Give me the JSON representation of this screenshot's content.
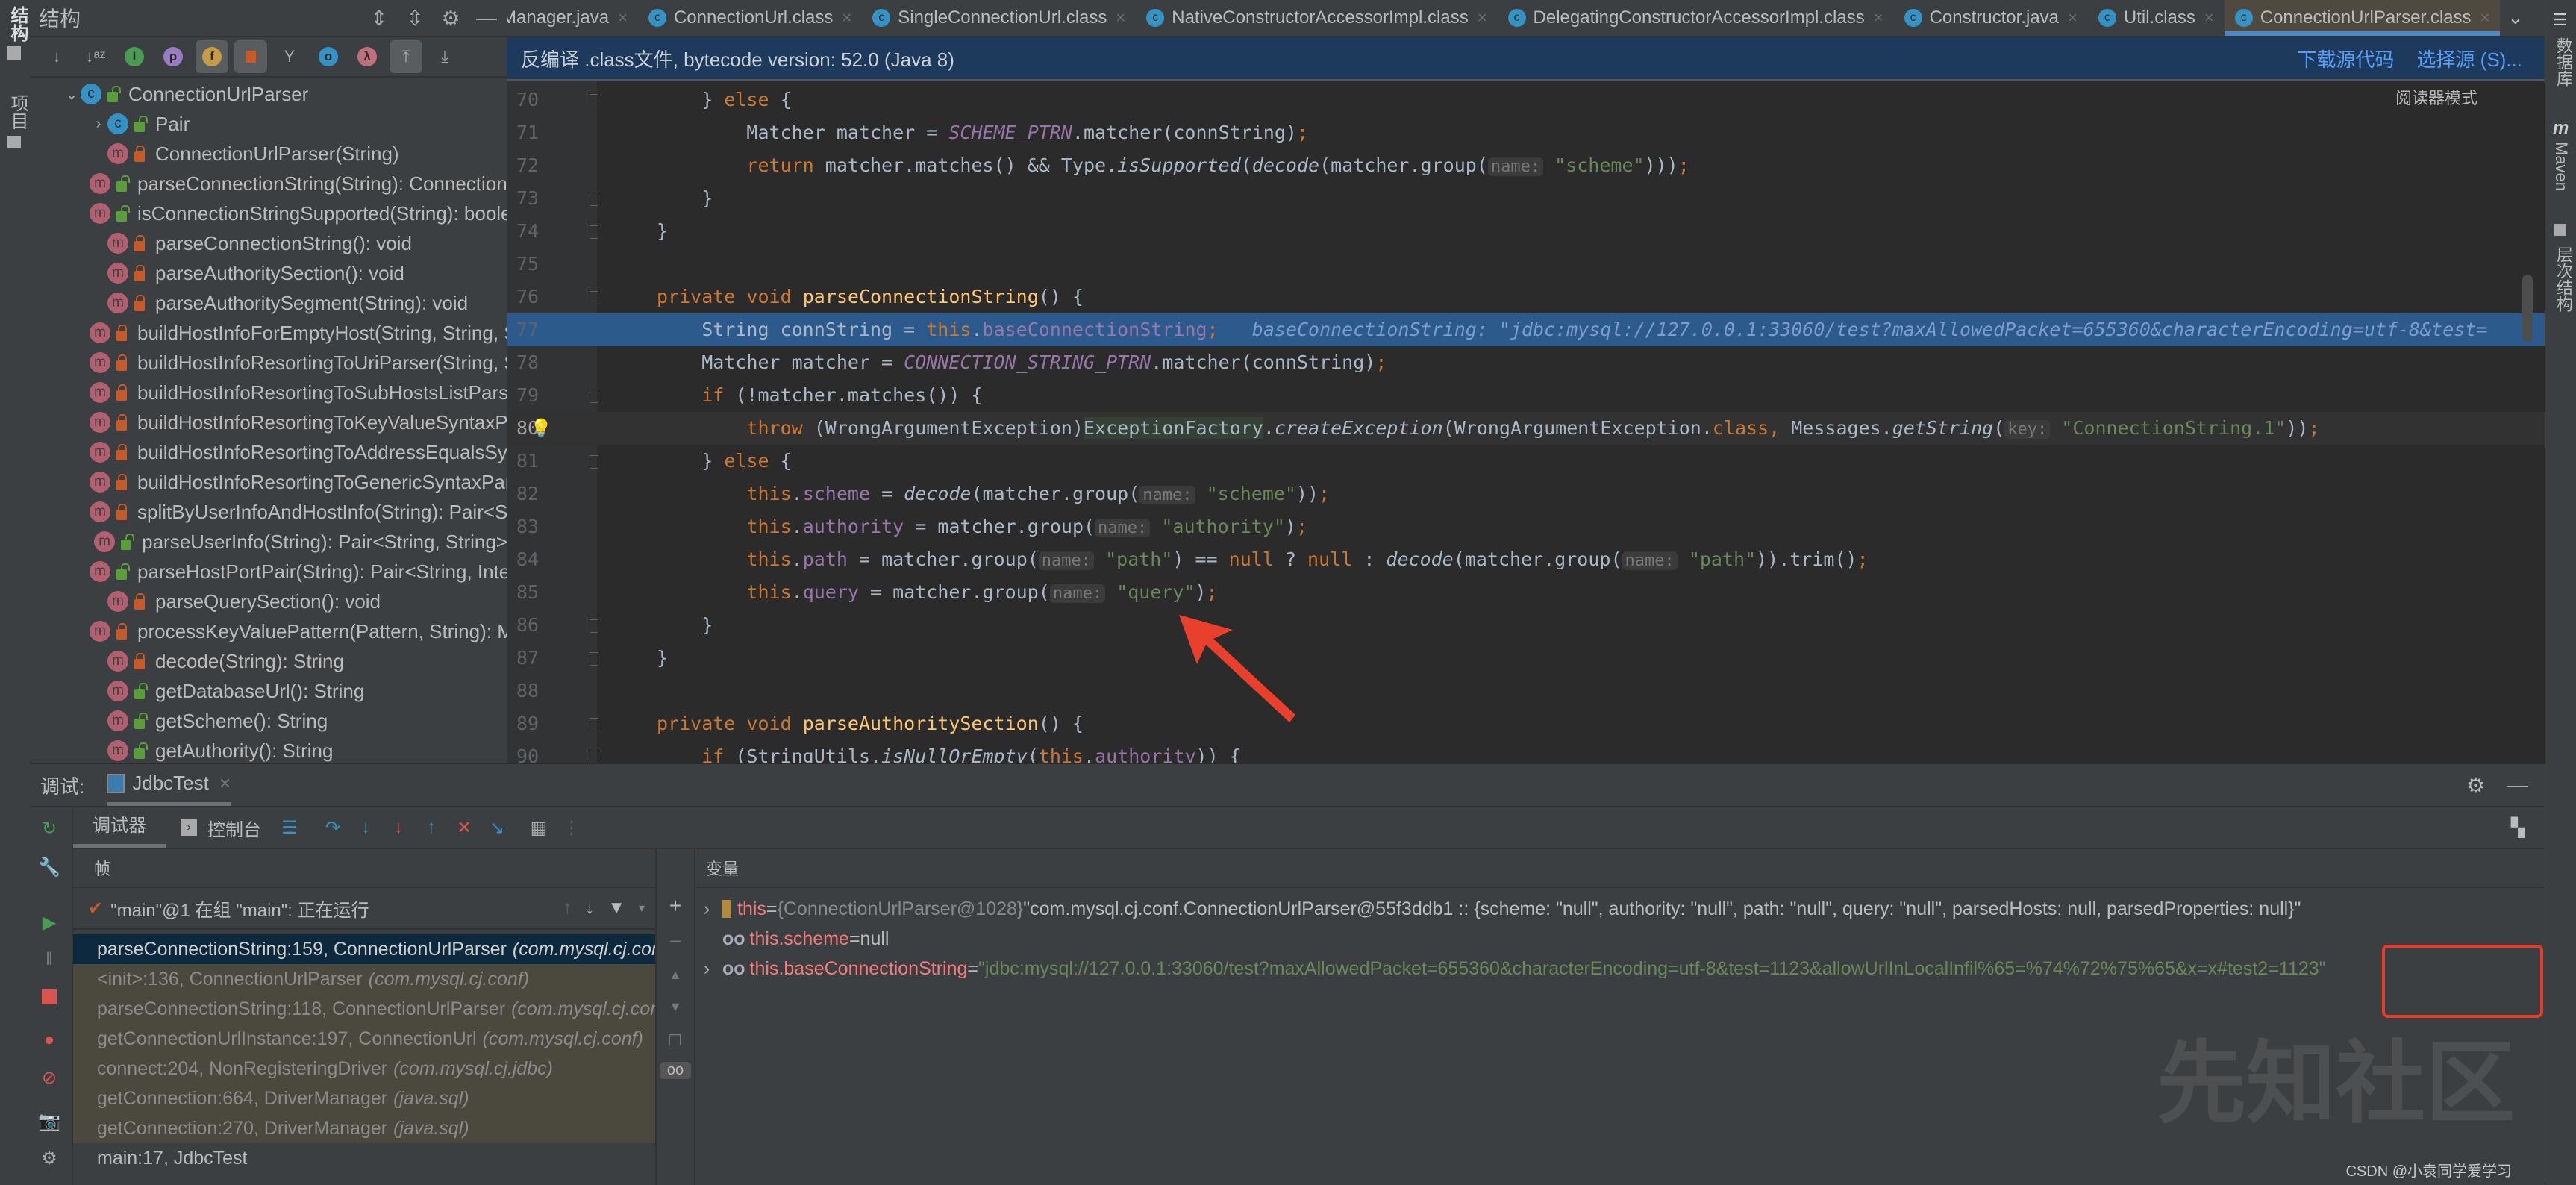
{
  "left_strip": {
    "structure_label": "结构",
    "project_label": "项目"
  },
  "right_strip": {
    "database_label": "数据库",
    "maven_label": "Maven",
    "hierarchy_label": "层次结构"
  },
  "structure": {
    "title": "结构",
    "root": "ConnectionUrlParser",
    "items": [
      {
        "label": "Pair",
        "kind": "class",
        "access": "public",
        "expandable": true
      },
      {
        "label": "ConnectionUrlParser(String)",
        "kind": "method",
        "access": "private"
      },
      {
        "label": "parseConnectionString(String): ConnectionUrlParser",
        "kind": "method",
        "access": "public"
      },
      {
        "label": "isConnectionStringSupported(String): boolean",
        "kind": "method",
        "access": "public"
      },
      {
        "label": "parseConnectionString(): void",
        "kind": "method",
        "access": "private"
      },
      {
        "label": "parseAuthoritySection(): void",
        "kind": "method",
        "access": "private"
      },
      {
        "label": "parseAuthoritySegment(String): void",
        "kind": "method",
        "access": "private"
      },
      {
        "label": "buildHostInfoForEmptyHost(String, String, String): HostInfo",
        "kind": "method",
        "access": "private"
      },
      {
        "label": "buildHostInfoResortingToUriParser(String, String, String): HostInfo",
        "kind": "method",
        "access": "private"
      },
      {
        "label": "buildHostInfoResortingToSubHostsListParser(String, String): List",
        "kind": "method",
        "access": "private"
      },
      {
        "label": "buildHostInfoResortingToKeyValueSyntaxParser(String, String): HostInfo",
        "kind": "method",
        "access": "private"
      },
      {
        "label": "buildHostInfoResortingToAddressEqualsSyntaxParser(String, String): HostInfo",
        "kind": "method",
        "access": "private"
      },
      {
        "label": "buildHostInfoResortingToGenericSyntaxParser(String, String): HostInfo",
        "kind": "method",
        "access": "private"
      },
      {
        "label": "splitByUserInfoAndHostInfo(String): Pair<String, String>",
        "kind": "method",
        "access": "private"
      },
      {
        "label": "parseUserInfo(String): Pair<String, String>",
        "kind": "method",
        "access": "public"
      },
      {
        "label": "parseHostPortPair(String): Pair<String, Integer>",
        "kind": "method",
        "access": "public"
      },
      {
        "label": "parseQuerySection(): void",
        "kind": "method",
        "access": "private"
      },
      {
        "label": "processKeyValuePattern(Pattern, String): Map",
        "kind": "method",
        "access": "private"
      },
      {
        "label": "decode(String): String",
        "kind": "method",
        "access": "private"
      },
      {
        "label": "getDatabaseUrl(): String",
        "kind": "method",
        "access": "public"
      },
      {
        "label": "getScheme(): String",
        "kind": "method",
        "access": "public"
      },
      {
        "label": "getAuthority(): String",
        "kind": "method",
        "access": "public"
      }
    ]
  },
  "tabs": [
    {
      "label": "Manager.java",
      "active": false
    },
    {
      "label": "ConnectionUrl.class",
      "active": false
    },
    {
      "label": "SingleConnectionUrl.class",
      "active": false
    },
    {
      "label": "NativeConstructorAccessorImpl.class",
      "active": false
    },
    {
      "label": "DelegatingConstructorAccessorImpl.class",
      "active": false
    },
    {
      "label": "Constructor.java",
      "active": false
    },
    {
      "label": "Util.class",
      "active": false
    },
    {
      "label": "ConnectionUrlParser.class",
      "active": true
    }
  ],
  "infobar": {
    "message": "反编译 .class文件, bytecode version: 52.0 (Java 8)",
    "download_source": "下载源代码",
    "choose_source": "选择源 (S)..."
  },
  "editor": {
    "reader_mode": "阅读器模式",
    "current_line": 77,
    "lines": [
      70,
      71,
      72,
      73,
      74,
      75,
      76,
      77,
      78,
      79,
      80,
      81,
      82,
      83,
      84,
      85,
      86,
      87,
      88,
      89,
      90
    ],
    "inline_value": "baseConnectionString: \"jdbc:mysql://127.0.0.1:33060/test?maxAllowedPacket=655360&characterEncoding=utf-8&test=",
    "hint_name": "name:",
    "hint_key": "key:"
  },
  "debug": {
    "title": "调试:",
    "session": "JdbcTest",
    "tab_debugger": "调试器",
    "tab_console": "控制台",
    "frames_label": "帧",
    "variables_label": "变量",
    "thread": "\"main\"@1 在组 \"main\": 正在运行",
    "frames": [
      {
        "method": "parseConnectionString:159, ConnectionUrlParser",
        "pkg": "(com.mysql.cj.conf)",
        "style": "selected"
      },
      {
        "method": "<init>:136, ConnectionUrlParser",
        "pkg": "(com.mysql.cj.conf)",
        "style": "lib"
      },
      {
        "method": "parseConnectionString:118, ConnectionUrlParser",
        "pkg": "(com.mysql.cj.conf)",
        "style": "lib"
      },
      {
        "method": "getConnectionUrlInstance:197, ConnectionUrl",
        "pkg": "(com.mysql.cj.conf)",
        "style": "lib"
      },
      {
        "method": "connect:204, NonRegisteringDriver",
        "pkg": "(com.mysql.cj.jdbc)",
        "style": "lib"
      },
      {
        "method": "getConnection:664, DriverManager",
        "pkg": "(java.sql)",
        "style": "lib"
      },
      {
        "method": "getConnection:270, DriverManager",
        "pkg": "(java.sql)",
        "style": "lib"
      },
      {
        "method": "main:17, JdbcTest",
        "pkg": "",
        "style": "normal"
      }
    ],
    "variables": [
      {
        "name": "this",
        "type": "{ConnectionUrlParser@1028}",
        "value": "\"com.mysql.cj.conf.ConnectionUrlParser@55f3ddb1 :: {scheme: \"null\", authority: \"null\", path: \"null\", query: \"null\", parsedHosts: null, parsedProperties: null}\""
      },
      {
        "name": "this.scheme",
        "type": "",
        "value": "null"
      },
      {
        "name": "this.baseConnectionString",
        "type": "",
        "value": "\"jdbc:mysql://127.0.0.1:33060/test?maxAllowedPacket=655360&characterEncoding=utf-8&test=1123&allowUrlInLocalInfil%65=%74%72%75%65&x=x#test2=1123\""
      }
    ]
  },
  "watermark": {
    "text": "先知社区",
    "credit": "CSDN @小袁同学爱学习"
  },
  "colors": {
    "accent": "#4a88c7",
    "highlight_line": "#2d5a8c",
    "annotation": "#e63c28"
  }
}
